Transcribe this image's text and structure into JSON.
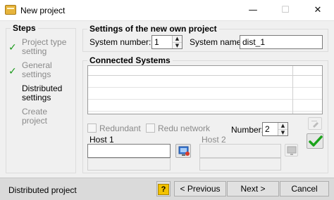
{
  "window": {
    "title": "New project",
    "minimize_glyph": "—",
    "maximize_glyph": "☐",
    "close_glyph": "✕"
  },
  "steps": {
    "title": "Steps",
    "items": [
      {
        "line1": "Project type",
        "line2": "setting",
        "state": "done"
      },
      {
        "line1": "General",
        "line2": "settings",
        "state": "done"
      },
      {
        "line1": "Distributed",
        "line2": "settings",
        "state": "current"
      },
      {
        "line1": "Create",
        "line2": "project",
        "state": "todo"
      }
    ],
    "check_glyph": "✓"
  },
  "settings": {
    "title": "Settings of the new own project",
    "system_number_label": "System number:",
    "system_number_value": "1",
    "system_name_label": "System name:",
    "system_name_value": "dist_1"
  },
  "connected_systems": {
    "title": "Connected Systems",
    "rows": 5,
    "redundant_label": "Redundant",
    "redu_network_label": "Redu network",
    "number_label": "Number:",
    "number_value": "2",
    "host1_label": "Host 1",
    "host1_value": "",
    "host2_label": "Host 2",
    "host2_value": ""
  },
  "footer": {
    "status": "Distributed project",
    "help_glyph": "?",
    "previous_label": "< Previous",
    "next_label": "Next >",
    "cancel_label": "Cancel"
  },
  "icons": {
    "app": "project-folder-icon",
    "host1_browse": "network-host-icon",
    "host2_browse": "network-host-icon",
    "edit": "edit-pencil-icon",
    "apply": "green-check-icon"
  },
  "colors": {
    "check_green": "#1a9a1a",
    "help_yellow": "#f2c200"
  }
}
